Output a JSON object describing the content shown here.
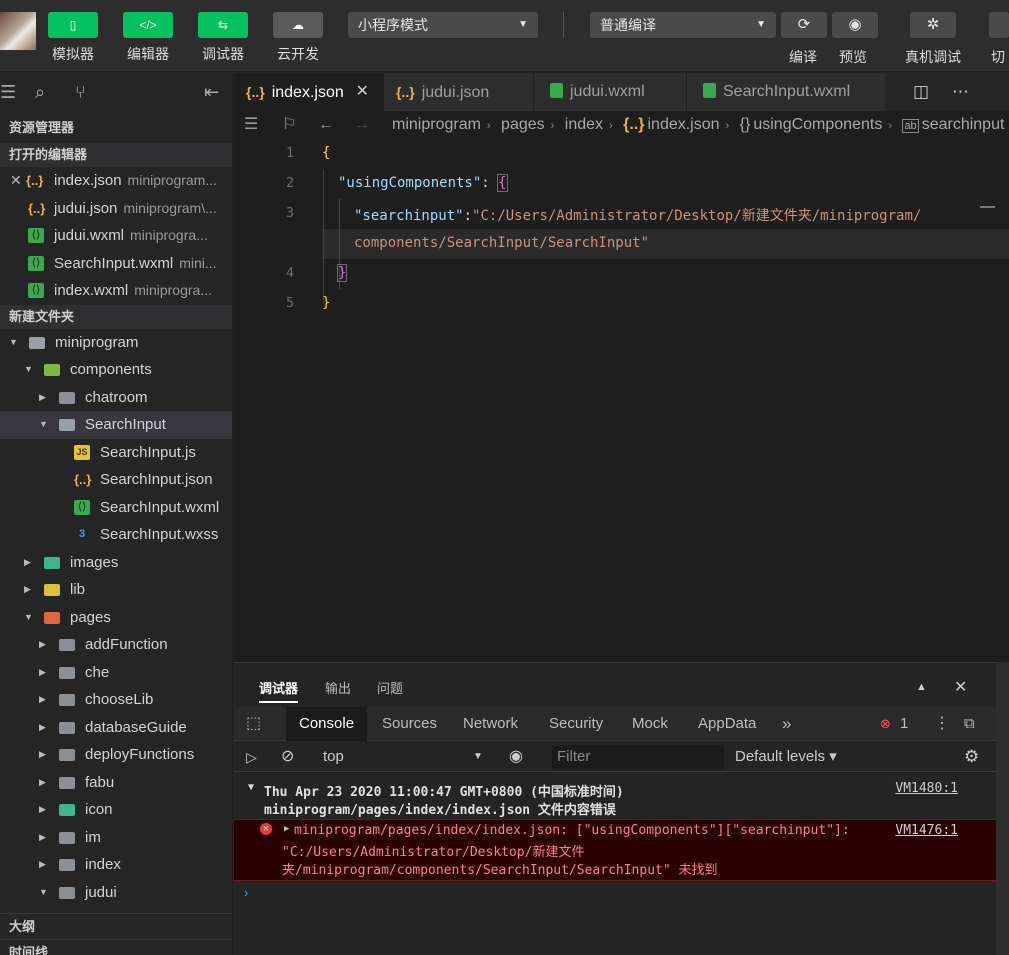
{
  "toolbar": {
    "buttons": [
      {
        "label": "模拟器",
        "icon": "phone-icon"
      },
      {
        "label": "编辑器",
        "icon": "code-icon"
      },
      {
        "label": "调试器",
        "icon": "debug-icon"
      },
      {
        "label": "云开发",
        "icon": "cloud-icon"
      }
    ],
    "mode_select": "小程序模式",
    "compile_select": "普通编译",
    "compile_label": "编译",
    "preview_label": "预览",
    "real_debug_label": "真机调试",
    "switch_label": "切"
  },
  "sidebar": {
    "explorer_title": "资源管理器",
    "open_editors_title": "打开的编辑器",
    "open_editors": [
      {
        "name": "index.json",
        "hint": "miniprogram...",
        "type": "json",
        "closable": true
      },
      {
        "name": "judui.json",
        "hint": "miniprogram\\...",
        "type": "json"
      },
      {
        "name": "judui.wxml",
        "hint": "miniprogra...",
        "type": "wxml"
      },
      {
        "name": "SearchInput.wxml",
        "hint": "mini...",
        "type": "wxml"
      },
      {
        "name": "index.wxml",
        "hint": "miniprogra...",
        "type": "wxml"
      }
    ],
    "project_title": "新建文件夹",
    "tree": [
      {
        "name": "miniprogram",
        "depth": 0,
        "arrow": "down",
        "icon": "folder-open"
      },
      {
        "name": "components",
        "depth": 1,
        "arrow": "down",
        "icon": "folder-green"
      },
      {
        "name": "chatroom",
        "depth": 2,
        "arrow": "right",
        "icon": "folder"
      },
      {
        "name": "SearchInput",
        "depth": 2,
        "arrow": "down",
        "icon": "folder-open",
        "selected": true
      },
      {
        "name": "SearchInput.js",
        "depth": 3,
        "icon": "js"
      },
      {
        "name": "SearchInput.json",
        "depth": 3,
        "icon": "json"
      },
      {
        "name": "SearchInput.wxml",
        "depth": 3,
        "icon": "wxml"
      },
      {
        "name": "SearchInput.wxss",
        "depth": 3,
        "icon": "wxss"
      },
      {
        "name": "images",
        "depth": 1,
        "arrow": "right",
        "icon": "folder-teal"
      },
      {
        "name": "lib",
        "depth": 1,
        "arrow": "right",
        "icon": "folder-yellow"
      },
      {
        "name": "pages",
        "depth": 1,
        "arrow": "down",
        "icon": "folder-red"
      },
      {
        "name": "addFunction",
        "depth": 2,
        "arrow": "right",
        "icon": "folder"
      },
      {
        "name": "che",
        "depth": 2,
        "arrow": "right",
        "icon": "folder"
      },
      {
        "name": "chooseLib",
        "depth": 2,
        "arrow": "right",
        "icon": "folder"
      },
      {
        "name": "databaseGuide",
        "depth": 2,
        "arrow": "right",
        "icon": "folder"
      },
      {
        "name": "deployFunctions",
        "depth": 2,
        "arrow": "right",
        "icon": "folder"
      },
      {
        "name": "fabu",
        "depth": 2,
        "arrow": "right",
        "icon": "folder"
      },
      {
        "name": "icon",
        "depth": 2,
        "arrow": "right",
        "icon": "folder-teal"
      },
      {
        "name": "im",
        "depth": 2,
        "arrow": "right",
        "icon": "folder"
      },
      {
        "name": "index",
        "depth": 2,
        "arrow": "right",
        "icon": "folder"
      },
      {
        "name": "judui",
        "depth": 2,
        "arrow": "down",
        "icon": "folder"
      }
    ],
    "outline_title": "大纲",
    "timeline_title": "时间线"
  },
  "tabs": [
    {
      "label": "index.json",
      "type": "json",
      "active": true
    },
    {
      "label": "judui.json",
      "type": "json"
    },
    {
      "label": "judui.wxml",
      "type": "wxml"
    },
    {
      "label": "SearchInput.wxml",
      "type": "wxml"
    }
  ],
  "breadcrumb": [
    "miniprogram",
    "pages",
    "index",
    "index.json",
    "usingComponents",
    "searchinput"
  ],
  "editor": {
    "line_numbers": [
      "1",
      "2",
      "3",
      "4",
      "5"
    ],
    "lines": {
      "l1_brace": "{",
      "l2_key": "\"usingComponents\"",
      "l2_colon": ": ",
      "l2_brace": "{",
      "l3_key": "\"searchinput\"",
      "l3_colon": ":",
      "l3_val_a": "\"C:/Users/Administrator/Desktop/新建文件夹/miniprogram/",
      "l3_val_b": "components/SearchInput/SearchInput\"",
      "l4_brace": "}",
      "l5_brace": "}"
    }
  },
  "panel": {
    "tabs": [
      "调试器",
      "输出",
      "问题"
    ],
    "devtools_tabs": [
      "Console",
      "Sources",
      "Network",
      "Security",
      "Mock",
      "AppData"
    ],
    "more": "»",
    "error_count": "1",
    "context": "top",
    "filter_placeholder": "Filter",
    "levels": "Default levels ▾",
    "log1_line1": "Thu Apr 23 2020 11:00:47 GMT+0800 (中国标准时间)",
    "log1_line2": "miniprogram/pages/index/index.json 文件内容错误",
    "log1_link": "VM1480:1",
    "log2_line1": "miniprogram/pages/index/index.json: [\"usingComponents\"][\"searchinput\"]:",
    "log2_line2": "\"C:/Users/Administrator/Desktop/新建文件",
    "log2_line3": "夹/miniprogram/components/SearchInput/SearchInput\" 未找到",
    "log2_link": "VM1476:1",
    "prompt": "›"
  }
}
